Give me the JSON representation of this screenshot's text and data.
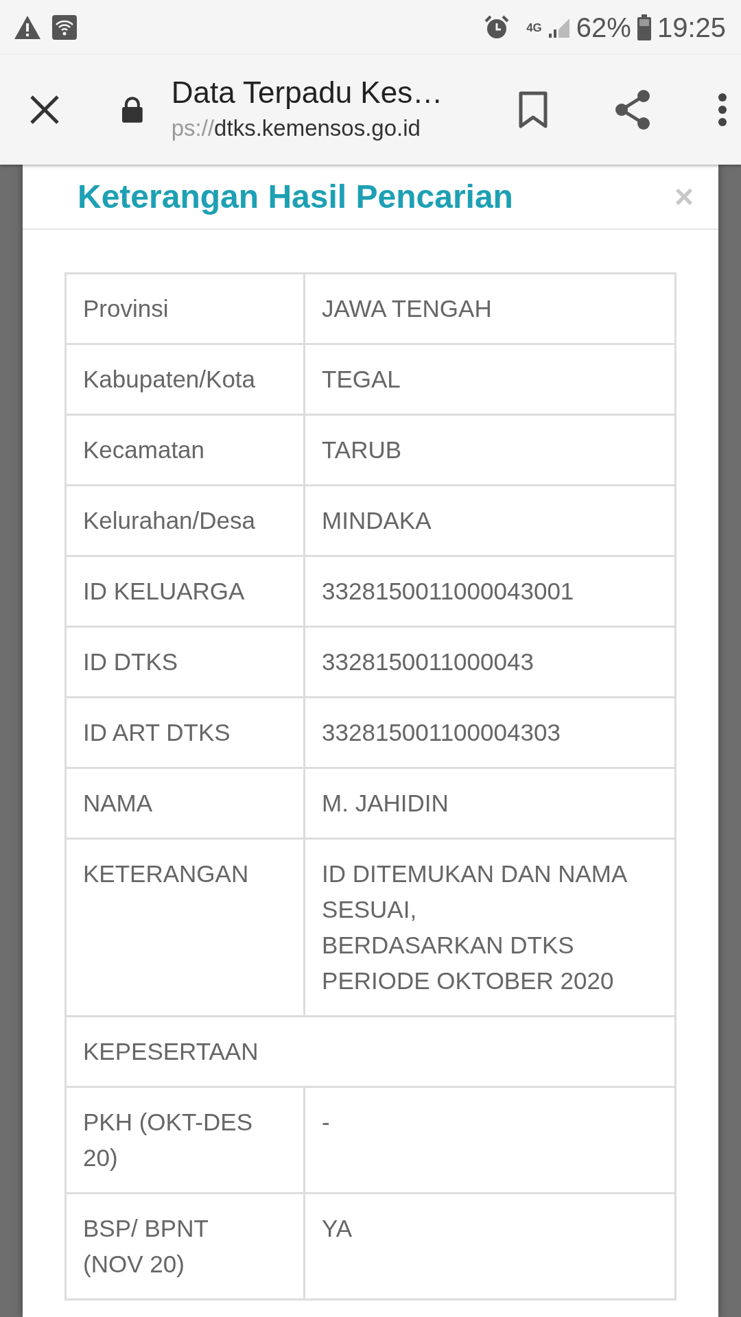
{
  "status_bar": {
    "network": "4G",
    "battery": "62%",
    "time": "19:25"
  },
  "browser_bar": {
    "title": "Data Terpadu Kes…",
    "url_scheme": "ps://",
    "url_host": "dtks.kemensos.go.id"
  },
  "modal": {
    "title": "Keterangan Hasil Pencarian",
    "close": "×",
    "rows": [
      {
        "kind": "pair",
        "label": "Provinsi",
        "value": "JAWA TENGAH"
      },
      {
        "kind": "pair",
        "label": "Kabupaten/Kota",
        "value": "TEGAL"
      },
      {
        "kind": "pair",
        "label": "Kecamatan",
        "value": "TARUB"
      },
      {
        "kind": "pair",
        "label": "Kelurahan/Desa",
        "value": "MINDAKA"
      },
      {
        "kind": "pair",
        "label": "ID KELUARGA",
        "value": "3328150011000043001"
      },
      {
        "kind": "pair",
        "label": "ID DTKS",
        "value": "3328150011000043"
      },
      {
        "kind": "pair",
        "label": "ID ART DTKS",
        "value": "332815001100004303"
      },
      {
        "kind": "pair",
        "label": "NAMA",
        "value": "M. JAHIDIN"
      },
      {
        "kind": "pair",
        "label": "KETERANGAN",
        "value": "ID DITEMUKAN DAN NAMA SESUAI,",
        "value_2": "BERDASARKAN DTKS PERIODE OKTOBER 2020"
      },
      {
        "kind": "section",
        "label": "KEPESERTAAN"
      },
      {
        "kind": "pair",
        "label": "PKH (OKT-DES 20)",
        "value": "-"
      },
      {
        "kind": "pair",
        "label": "BSP/ BPNT (NOV 20)",
        "value": "YA"
      }
    ]
  }
}
